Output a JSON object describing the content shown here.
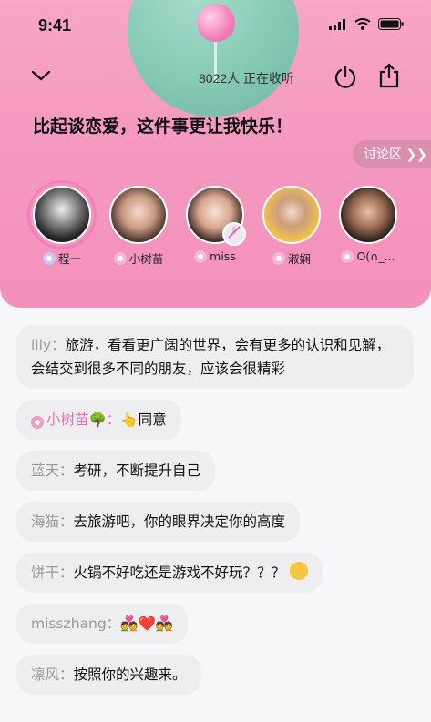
{
  "status_bar": {
    "time": "9:41"
  },
  "room": {
    "listeners_text": "8022人 正在收听",
    "title": "比起谈恋爱，这件事更让我快乐！",
    "discussion_label": "讨论区 ❯❯"
  },
  "speakers": [
    {
      "name": "程一",
      "role": "host"
    },
    {
      "name": "小树苗"
    },
    {
      "name": "miss",
      "muted": true
    },
    {
      "name": "淑娴"
    },
    {
      "name": "O(∩_..."
    }
  ],
  "messages": [
    {
      "nick": "lily：",
      "text": "旅游，看看更广阔的世界，会有更多的认识和见解，会结交到很多不同的朋友，应该会很精彩"
    },
    {
      "nick": "小树苗🌳：",
      "text": "👆同意"
    },
    {
      "nick": "蓝天：",
      "text": "考研，不断提升自己"
    },
    {
      "nick": "海猫：",
      "text": "去旅游吧，你的眼界决定你的高度"
    },
    {
      "nick": "饼干：",
      "text": "火锅不好吃还是游戏不好玩？？？"
    },
    {
      "nick": "misszhang：",
      "text": "💑❤️💑"
    },
    {
      "nick": "凛风：",
      "text": "按照你的兴趣来。"
    }
  ],
  "colors": {
    "header_pink": "#f59ac0",
    "bubble": "#eeeef0",
    "accent_pink": "#e96fb0"
  }
}
